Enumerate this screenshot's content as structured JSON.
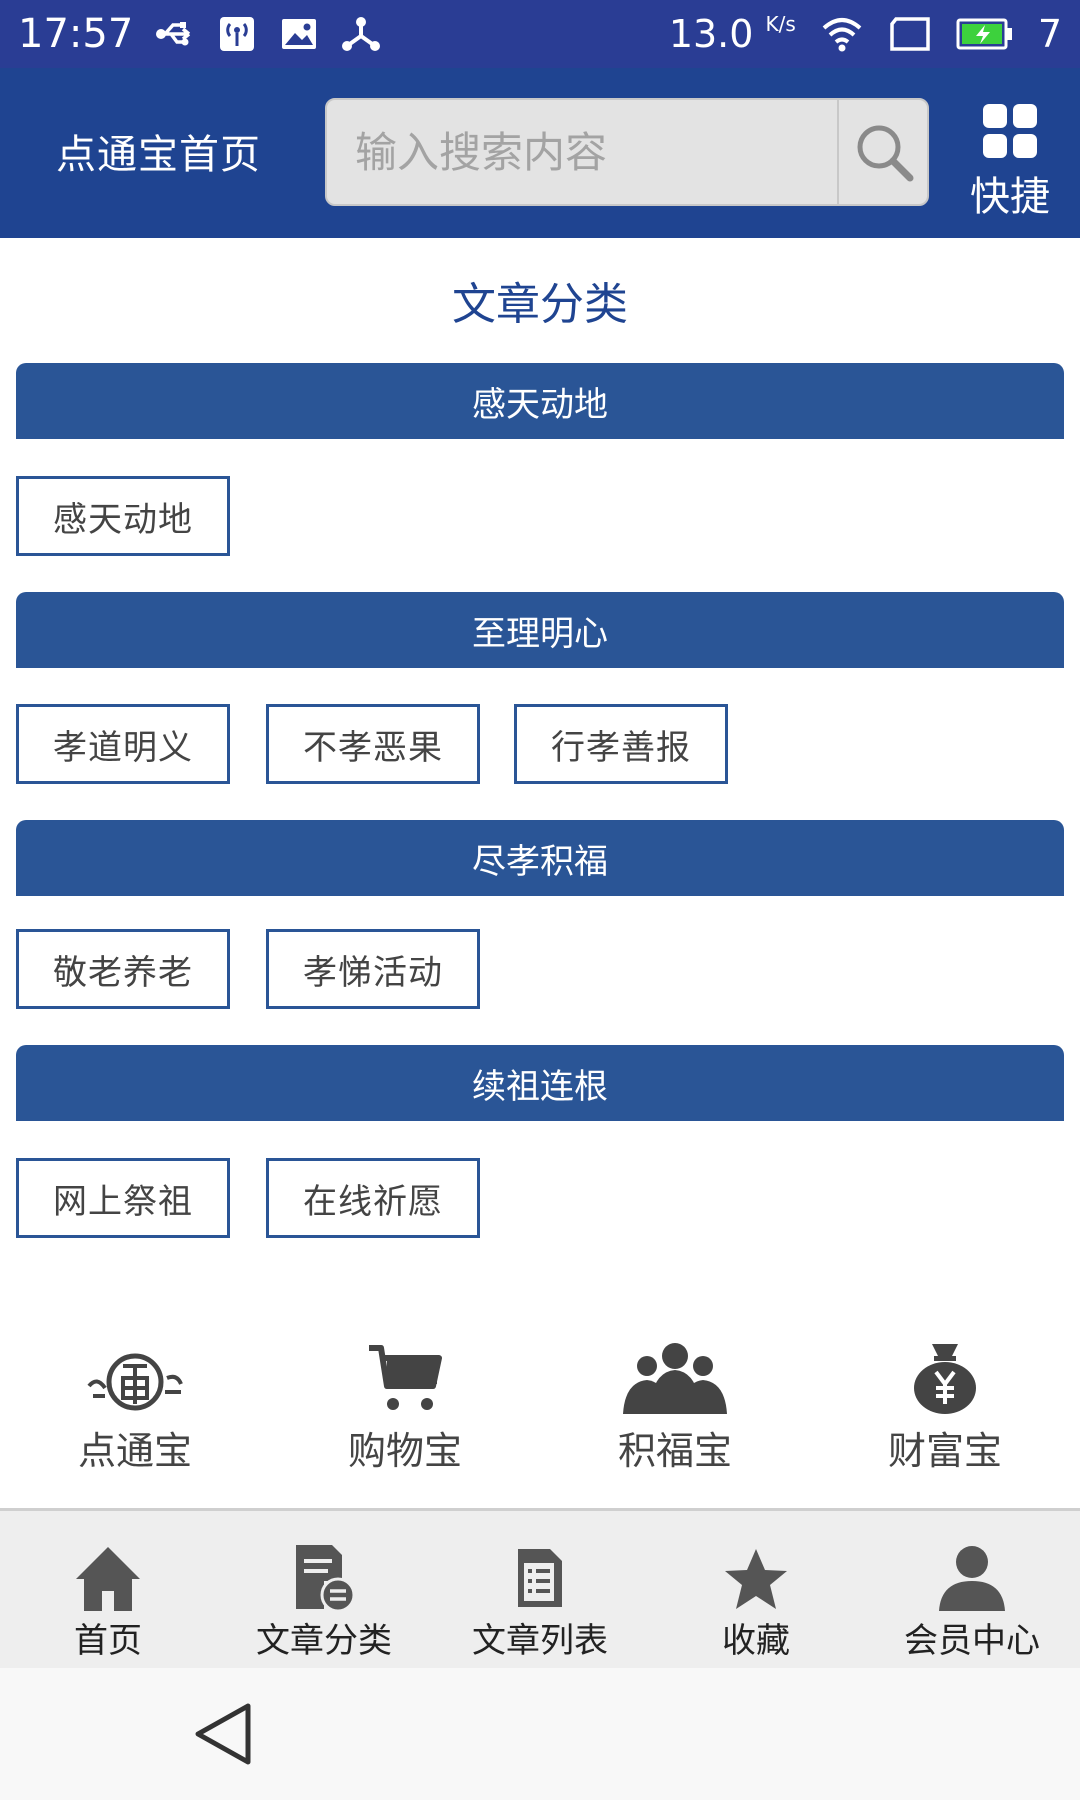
{
  "status_bar": {
    "time": "17:57",
    "net_speed": "13.0",
    "net_speed_unit": "K/s",
    "battery_level": "7",
    "icons_left": [
      "usb-icon",
      "wireless-icon",
      "image-icon",
      "usb-tether-icon"
    ],
    "icons_right": [
      "wifi-icon",
      "sim-icon",
      "battery-icon"
    ]
  },
  "header": {
    "title": "点通宝首页",
    "search_placeholder": "输入搜索内容",
    "search_value": "",
    "quick_label": "快捷"
  },
  "page_title": "文章分类",
  "categories": [
    {
      "label": "感天动地",
      "tags": [
        "感天动地"
      ]
    },
    {
      "label": "至理明心",
      "tags": [
        "孝道明义",
        "不孝恶果",
        "行孝善报"
      ]
    },
    {
      "label": "尽孝积福",
      "tags": [
        "敬老养老",
        "孝悌活动"
      ]
    },
    {
      "label": "续祖连根",
      "tags": [
        "网上祭祖",
        "在线祈愿"
      ]
    }
  ],
  "quick_links": [
    {
      "label": "点通宝",
      "icon": "dtb-logo-icon"
    },
    {
      "label": "购物宝",
      "icon": "cart-icon"
    },
    {
      "label": "积福宝",
      "icon": "people-icon"
    },
    {
      "label": "财富宝",
      "icon": "money-bag-icon"
    }
  ],
  "tab_bar": [
    {
      "label": "首页",
      "icon": "home-icon"
    },
    {
      "label": "文章分类",
      "icon": "doc-category-icon"
    },
    {
      "label": "文章列表",
      "icon": "doc-list-icon"
    },
    {
      "label": "收藏",
      "icon": "star-icon"
    },
    {
      "label": "会员中心",
      "icon": "user-icon"
    }
  ],
  "colors": {
    "status_bar": "#2a3d94",
    "app_bar": "#1f4491",
    "category_bar": "#2a5596",
    "tab_bar_bg": "#eeeeee",
    "icon_gray": "#555555"
  }
}
